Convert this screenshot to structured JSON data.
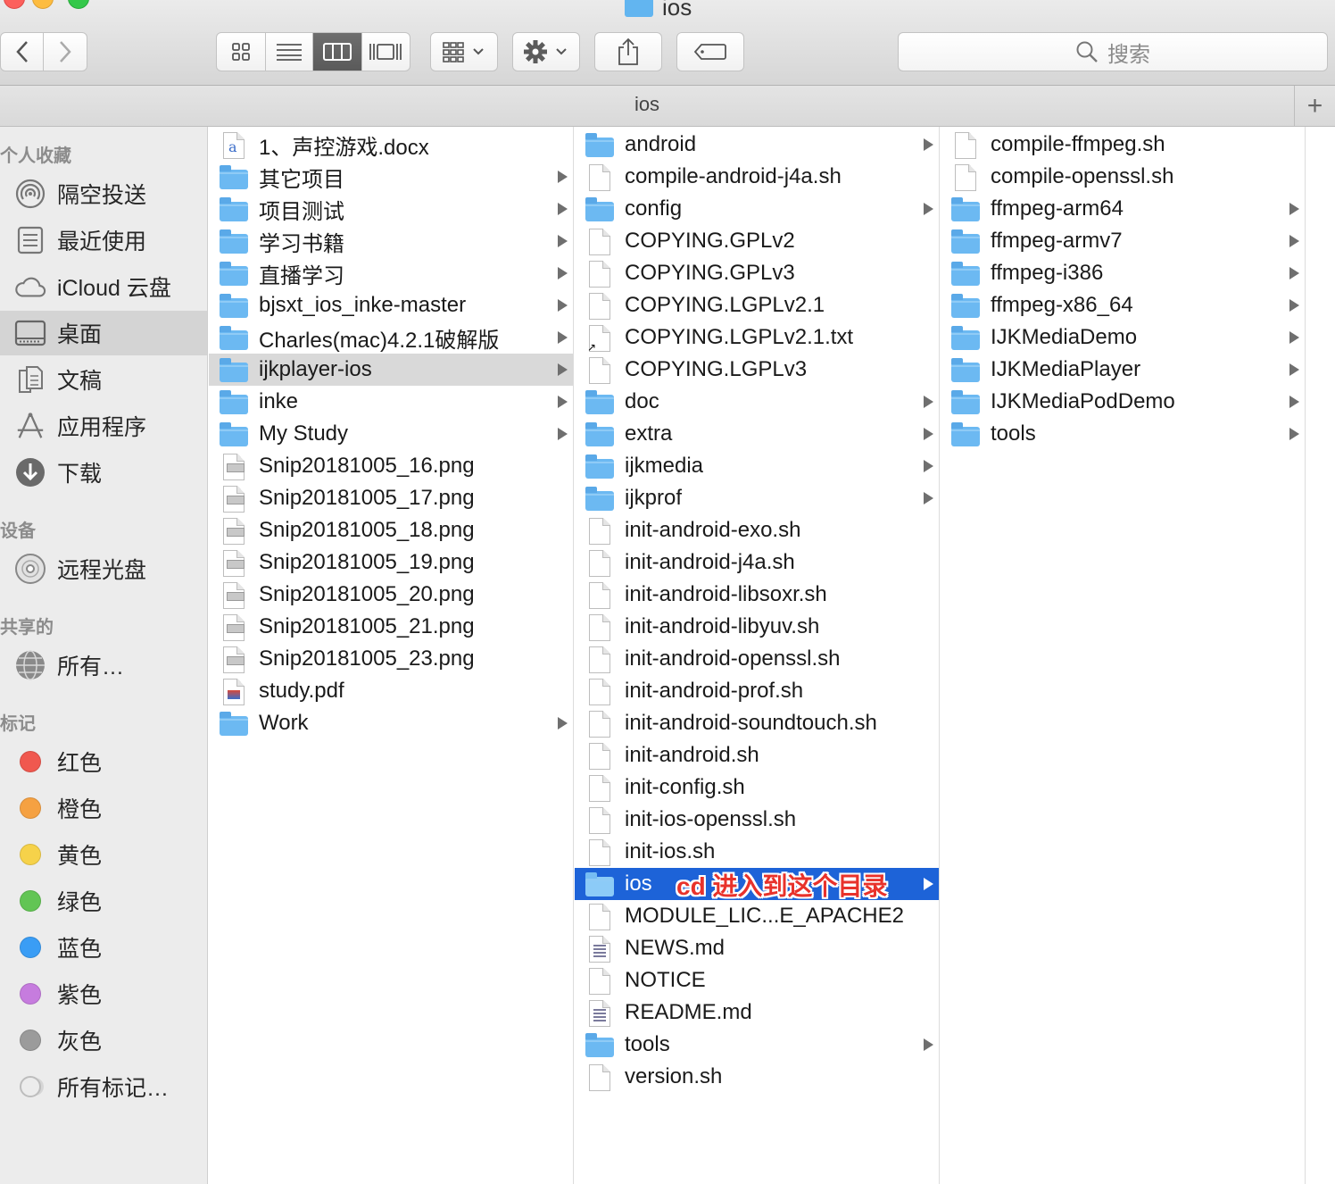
{
  "window": {
    "title": "ios"
  },
  "toolbar": {
    "search_placeholder": "搜索"
  },
  "pathbar": {
    "title": "ios",
    "add_label": "+"
  },
  "sidebar": {
    "sections": {
      "favorites": "个人收藏",
      "devices": "设备",
      "shared": "共享的",
      "tags": "标记"
    },
    "favorites": [
      {
        "label": "隔空投送",
        "icon": "airdrop-icon"
      },
      {
        "label": "最近使用",
        "icon": "recents-icon"
      },
      {
        "label": "iCloud 云盘",
        "icon": "icloud-icon"
      },
      {
        "label": "桌面",
        "icon": "desktop-icon",
        "selected": true
      },
      {
        "label": "文稿",
        "icon": "documents-icon"
      },
      {
        "label": "应用程序",
        "icon": "applications-icon"
      },
      {
        "label": "下载",
        "icon": "downloads-icon"
      }
    ],
    "devices": [
      {
        "label": "远程光盘",
        "icon": "disc-icon"
      }
    ],
    "shared": [
      {
        "label": "所有…",
        "icon": "network-icon"
      }
    ],
    "tags": [
      {
        "label": "红色",
        "color": "#f0584f"
      },
      {
        "label": "橙色",
        "color": "#f5a142"
      },
      {
        "label": "黄色",
        "color": "#f6d24a"
      },
      {
        "label": "绿色",
        "color": "#62c554"
      },
      {
        "label": "蓝色",
        "color": "#3a9df5"
      },
      {
        "label": "紫色",
        "color": "#c67cde"
      },
      {
        "label": "灰色",
        "color": "#9b9b9b"
      },
      {
        "label": "所有标记…",
        "color": "#e6e6e6"
      }
    ]
  },
  "columns": [
    [
      {
        "name": "1、声控游戏.docx",
        "kind": "word"
      },
      {
        "name": "其它项目",
        "kind": "folder"
      },
      {
        "name": "项目测试",
        "kind": "folder"
      },
      {
        "name": "学习书籍",
        "kind": "folder"
      },
      {
        "name": "直播学习",
        "kind": "folder"
      },
      {
        "name": "bjsxt_ios_inke-master",
        "kind": "folder"
      },
      {
        "name": "Charles(mac)4.2.1破解版",
        "kind": "folder"
      },
      {
        "name": "ijkplayer-ios",
        "kind": "folder",
        "selected": "gray"
      },
      {
        "name": "inke",
        "kind": "folder"
      },
      {
        "name": "My Study",
        "kind": "folder"
      },
      {
        "name": "Snip20181005_16.png",
        "kind": "img"
      },
      {
        "name": "Snip20181005_17.png",
        "kind": "img"
      },
      {
        "name": "Snip20181005_18.png",
        "kind": "img"
      },
      {
        "name": "Snip20181005_19.png",
        "kind": "img"
      },
      {
        "name": "Snip20181005_20.png",
        "kind": "img"
      },
      {
        "name": "Snip20181005_21.png",
        "kind": "img"
      },
      {
        "name": "Snip20181005_23.png",
        "kind": "img"
      },
      {
        "name": "study.pdf",
        "kind": "pdf"
      },
      {
        "name": "Work",
        "kind": "folder"
      }
    ],
    [
      {
        "name": "android",
        "kind": "folder"
      },
      {
        "name": "compile-android-j4a.sh",
        "kind": "doc"
      },
      {
        "name": "config",
        "kind": "folder"
      },
      {
        "name": "COPYING.GPLv2",
        "kind": "doc"
      },
      {
        "name": "COPYING.GPLv3",
        "kind": "doc"
      },
      {
        "name": "COPYING.LGPLv2.1",
        "kind": "doc"
      },
      {
        "name": "COPYING.LGPLv2.1.txt",
        "kind": "alias"
      },
      {
        "name": "COPYING.LGPLv3",
        "kind": "doc"
      },
      {
        "name": "doc",
        "kind": "folder"
      },
      {
        "name": "extra",
        "kind": "folder"
      },
      {
        "name": "ijkmedia",
        "kind": "folder"
      },
      {
        "name": "ijkprof",
        "kind": "folder"
      },
      {
        "name": "init-android-exo.sh",
        "kind": "doc"
      },
      {
        "name": "init-android-j4a.sh",
        "kind": "doc"
      },
      {
        "name": "init-android-libsoxr.sh",
        "kind": "doc"
      },
      {
        "name": "init-android-libyuv.sh",
        "kind": "doc"
      },
      {
        "name": "init-android-openssl.sh",
        "kind": "doc"
      },
      {
        "name": "init-android-prof.sh",
        "kind": "doc"
      },
      {
        "name": "init-android-soundtouch.sh",
        "kind": "doc"
      },
      {
        "name": "init-android.sh",
        "kind": "doc"
      },
      {
        "name": "init-config.sh",
        "kind": "doc"
      },
      {
        "name": "init-ios-openssl.sh",
        "kind": "doc"
      },
      {
        "name": "init-ios.sh",
        "kind": "doc"
      },
      {
        "name": "ios",
        "kind": "folder",
        "selected": "blue"
      },
      {
        "name": "MODULE_LIC...E_APACHE2",
        "kind": "doc"
      },
      {
        "name": "NEWS.md",
        "kind": "md"
      },
      {
        "name": "NOTICE",
        "kind": "doc"
      },
      {
        "name": "README.md",
        "kind": "md"
      },
      {
        "name": "tools",
        "kind": "folder"
      },
      {
        "name": "version.sh",
        "kind": "doc"
      }
    ],
    [
      {
        "name": "compile-ffmpeg.sh",
        "kind": "doc"
      },
      {
        "name": "compile-openssl.sh",
        "kind": "doc"
      },
      {
        "name": "ffmpeg-arm64",
        "kind": "folder"
      },
      {
        "name": "ffmpeg-armv7",
        "kind": "folder"
      },
      {
        "name": "ffmpeg-i386",
        "kind": "folder"
      },
      {
        "name": "ffmpeg-x86_64",
        "kind": "folder"
      },
      {
        "name": "IJKMediaDemo",
        "kind": "folder"
      },
      {
        "name": "IJKMediaPlayer",
        "kind": "folder"
      },
      {
        "name": "IJKMediaPodDemo",
        "kind": "folder"
      },
      {
        "name": "tools",
        "kind": "folder"
      }
    ]
  ],
  "annotation": {
    "text": "cd 进入到这个目录",
    "color": "#e8322b"
  }
}
